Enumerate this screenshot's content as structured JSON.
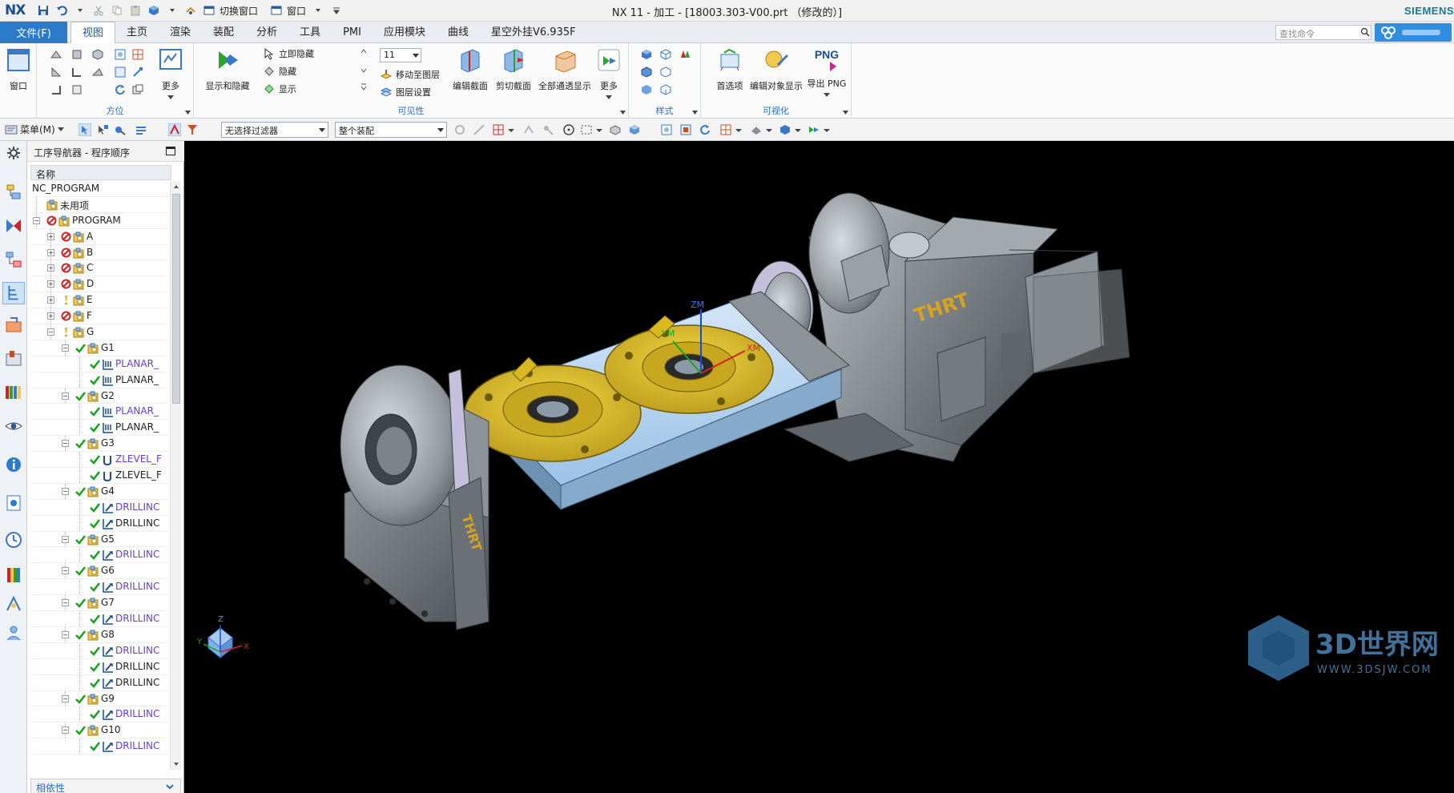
{
  "app": {
    "logo": "NX",
    "window_title": "NX 11 - 加工 - [18003.303-V00.prt （修改的）]",
    "brand": "SIEMENS"
  },
  "quick_access": {
    "switch_window_label": "切换窗口",
    "window_label": "窗口"
  },
  "tabs": {
    "file": "文件(F)",
    "items": [
      "视图",
      "主页",
      "渲染",
      "装配",
      "分析",
      "工具",
      "PMI",
      "应用模块",
      "曲线",
      "星空外挂V6.935F"
    ],
    "active": "视图"
  },
  "search": {
    "placeholder": "查找命令"
  },
  "ribbon": {
    "window_group": {
      "label": "窗口"
    },
    "orientation_group": {
      "label": "方位",
      "more": "更多"
    },
    "visibility_group": {
      "label": "可见性",
      "show_hide": "显示和隐藏",
      "hide_immediately": "立即隐藏",
      "hide": "隐藏",
      "show": "显示",
      "layer_value": "11",
      "move_to_layer": "移动至图层",
      "layer_settings": "图层设置",
      "edit_section": "编辑截面",
      "clip_section": "剪切截面",
      "show_all_through": "全部通透显示",
      "more": "更多"
    },
    "style_group": {
      "label": "样式"
    },
    "visualization_group": {
      "label": "可视化",
      "preferences": "首选项",
      "edit_object_display": "编辑对象显示",
      "export_png": "导出 PNG",
      "png_icon_text": "PNG"
    }
  },
  "command_bar": {
    "menu": "菜单(M)",
    "filter": "无选择过滤器",
    "scope": "整个装配"
  },
  "navigator": {
    "title": "工序导航器 - 程序顺序",
    "column_header": "名称",
    "dependencies": "相依性",
    "rows": [
      {
        "label": "NC_PROGRAM",
        "level": 0,
        "expander": "",
        "status": "",
        "icon": "",
        "kind": "plain"
      },
      {
        "label": "未用项",
        "level": 1,
        "expander": "",
        "status": "",
        "icon": "group",
        "kind": "plain"
      },
      {
        "label": "PROGRAM",
        "level": 1,
        "expander": "−",
        "status": "forbidden",
        "icon": "group",
        "kind": "plain"
      },
      {
        "label": "A",
        "level": 2,
        "expander": "+",
        "status": "forbidden",
        "icon": "group",
        "kind": "plain"
      },
      {
        "label": "B",
        "level": 2,
        "expander": "+",
        "status": "forbidden",
        "icon": "group",
        "kind": "plain"
      },
      {
        "label": "C",
        "level": 2,
        "expander": "+",
        "status": "forbidden",
        "icon": "group",
        "kind": "plain"
      },
      {
        "label": "D",
        "level": 2,
        "expander": "+",
        "status": "forbidden",
        "icon": "group",
        "kind": "plain"
      },
      {
        "label": "E",
        "level": 2,
        "expander": "+",
        "status": "warning",
        "icon": "group",
        "kind": "plain"
      },
      {
        "label": "F",
        "level": 2,
        "expander": "+",
        "status": "forbidden",
        "icon": "group",
        "kind": "plain"
      },
      {
        "label": "G",
        "level": 2,
        "expander": "−",
        "status": "warning",
        "icon": "group",
        "kind": "plain"
      },
      {
        "label": "G1",
        "level": 3,
        "expander": "−",
        "status": "ok",
        "icon": "group",
        "kind": "plain"
      },
      {
        "label": "PLANAR_",
        "level": 4,
        "expander": "",
        "status": "ok",
        "icon": "planar",
        "kind": "op"
      },
      {
        "label": "PLANAR_",
        "level": 4,
        "expander": "",
        "status": "ok",
        "icon": "planar",
        "kind": "op-plain"
      },
      {
        "label": "G2",
        "level": 3,
        "expander": "−",
        "status": "ok",
        "icon": "group",
        "kind": "plain"
      },
      {
        "label": "PLANAR_",
        "level": 4,
        "expander": "",
        "status": "ok",
        "icon": "planar",
        "kind": "op"
      },
      {
        "label": "PLANAR_",
        "level": 4,
        "expander": "",
        "status": "ok",
        "icon": "planar",
        "kind": "op-plain"
      },
      {
        "label": "G3",
        "level": 3,
        "expander": "−",
        "status": "ok",
        "icon": "group",
        "kind": "plain"
      },
      {
        "label": "ZLEVEL_F",
        "level": 4,
        "expander": "",
        "status": "ok",
        "icon": "zlevel",
        "kind": "op"
      },
      {
        "label": "ZLEVEL_F",
        "level": 4,
        "expander": "",
        "status": "ok",
        "icon": "zlevel",
        "kind": "op-plain"
      },
      {
        "label": "G4",
        "level": 3,
        "expander": "−",
        "status": "ok",
        "icon": "group",
        "kind": "plain"
      },
      {
        "label": "DRILLINC",
        "level": 4,
        "expander": "",
        "status": "ok",
        "icon": "drill",
        "kind": "op"
      },
      {
        "label": "DRILLINC",
        "level": 4,
        "expander": "",
        "status": "ok",
        "icon": "drill",
        "kind": "op-plain"
      },
      {
        "label": "G5",
        "level": 3,
        "expander": "−",
        "status": "ok",
        "icon": "group",
        "kind": "plain"
      },
      {
        "label": "DRILLINC",
        "level": 4,
        "expander": "",
        "status": "ok",
        "icon": "drill",
        "kind": "op"
      },
      {
        "label": "G6",
        "level": 3,
        "expander": "−",
        "status": "ok",
        "icon": "group",
        "kind": "plain"
      },
      {
        "label": "DRILLINC",
        "level": 4,
        "expander": "",
        "status": "ok",
        "icon": "drill",
        "kind": "op"
      },
      {
        "label": "G7",
        "level": 3,
        "expander": "−",
        "status": "ok",
        "icon": "group",
        "kind": "plain"
      },
      {
        "label": "DRILLINC",
        "level": 4,
        "expander": "",
        "status": "ok",
        "icon": "drill",
        "kind": "op"
      },
      {
        "label": "G8",
        "level": 3,
        "expander": "−",
        "status": "ok",
        "icon": "group",
        "kind": "plain"
      },
      {
        "label": "DRILLINC",
        "level": 4,
        "expander": "",
        "status": "ok",
        "icon": "drill",
        "kind": "op"
      },
      {
        "label": "DRILLINC",
        "level": 4,
        "expander": "",
        "status": "ok",
        "icon": "drill",
        "kind": "op-plain"
      },
      {
        "label": "DRILLINC",
        "level": 4,
        "expander": "",
        "status": "ok",
        "icon": "drill",
        "kind": "op-plain"
      },
      {
        "label": "G9",
        "level": 3,
        "expander": "−",
        "status": "ok",
        "icon": "group",
        "kind": "plain"
      },
      {
        "label": "DRILLINC",
        "level": 4,
        "expander": "",
        "status": "ok",
        "icon": "drill",
        "kind": "op"
      },
      {
        "label": "G10",
        "level": 3,
        "expander": "−",
        "status": "ok",
        "icon": "group",
        "kind": "plain"
      },
      {
        "label": "DRILLINC",
        "level": 4,
        "expander": "",
        "status": "ok",
        "icon": "drill",
        "kind": "op"
      }
    ]
  },
  "graphics": {
    "rotary_label_top": "THRT",
    "rotary_label_side": "THRT",
    "csys_labels": {
      "zm": "ZM",
      "ym": "YM",
      "xm": "XM"
    },
    "triad_labels": {
      "x": "X",
      "y": "Y",
      "z": "Z"
    },
    "watermark_main": "3D世界网",
    "watermark_url": "WWW.3DSJW.COM"
  },
  "colors": {
    "accent": "#2b7bc8",
    "operation_text": "#6a3cc8",
    "ok_check": "#17a317",
    "forbidden": "#d42020",
    "warning": "#e0b400",
    "part_yellow": "#e3c21a",
    "fixture_blue": "#bcd8f2",
    "rotary_gray": "#8c9398"
  }
}
